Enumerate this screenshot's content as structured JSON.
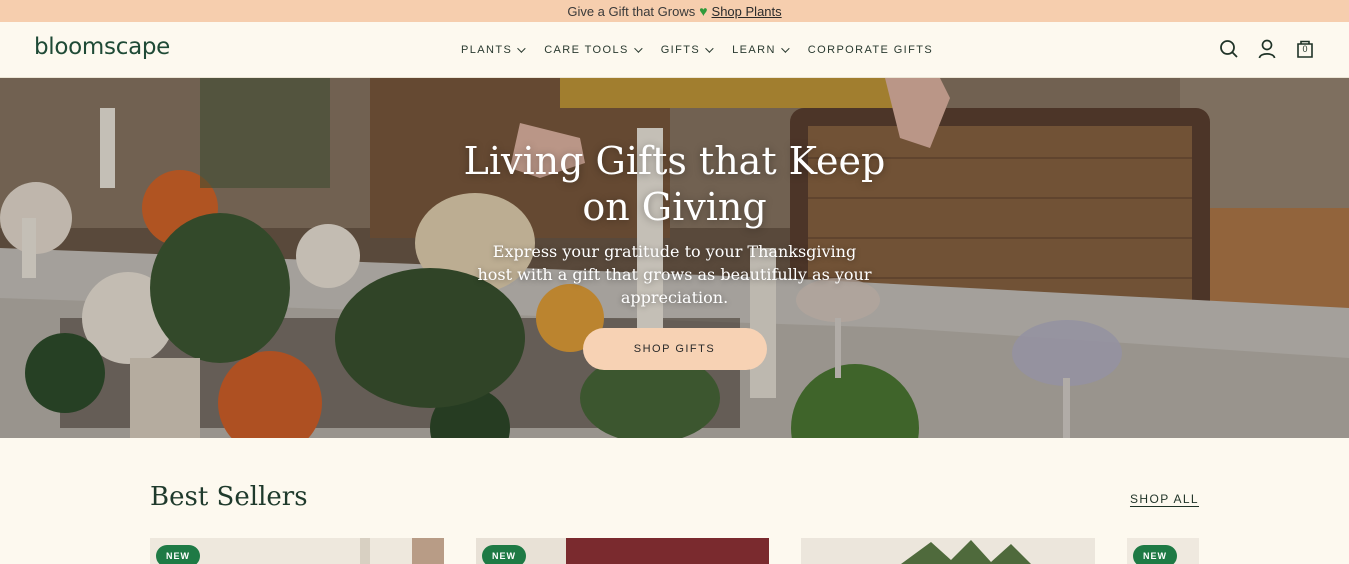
{
  "promo": {
    "text": "Give a Gift that Grows",
    "link": "Shop Plants"
  },
  "header": {
    "logo": "bloomscape",
    "menu": [
      {
        "label": "PLANTS"
      },
      {
        "label": "CARE TOOLS"
      },
      {
        "label": "GIFTS"
      },
      {
        "label": "LEARN"
      },
      {
        "label": "CORPORATE GIFTS"
      }
    ],
    "cart_count": "0"
  },
  "hero": {
    "title": "Living Gifts that Keep on Giving",
    "subtitle": "Express your gratitude to your Thanksgiving host with a gift that grows as beautifully as your appreciation.",
    "button": "SHOP GIFTS"
  },
  "best_sellers": {
    "title": "Best Sellers",
    "shop_all": "SHOP ALL",
    "badge": "NEW"
  },
  "colors": {
    "promo_bg": "#f6ceae",
    "page_bg": "#fdf9ef",
    "brand_green": "#1f4a36",
    "badge_green": "#1e7a45",
    "button_peach": "#f7d2b4"
  }
}
